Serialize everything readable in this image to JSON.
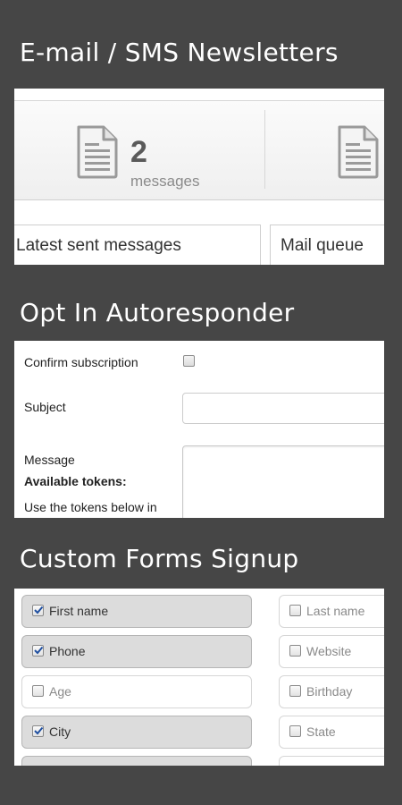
{
  "sections": {
    "newsletters": {
      "title": "E-mail / SMS Newsletters"
    },
    "autoresponder": {
      "title": "Opt In Autoresponder"
    },
    "custom_forms": {
      "title": "Custom Forms Signup"
    }
  },
  "stats": {
    "message_count": "2",
    "message_label": "messages"
  },
  "tabs": [
    {
      "label": "Latest sent messages"
    },
    {
      "label": "Mail queue"
    }
  ],
  "autoresponder_form": {
    "confirm_label": "Confirm subscription",
    "confirm_checked": false,
    "subject_label": "Subject",
    "subject_value": "",
    "message_label": "Message",
    "tokens_heading": "Available tokens:",
    "tokens_hint": "Use the tokens below in"
  },
  "signup_fields": [
    {
      "label": "First name",
      "checked": true
    },
    {
      "label": "Last name",
      "checked": false
    },
    {
      "label": "Phone",
      "checked": true
    },
    {
      "label": "Website",
      "checked": false
    },
    {
      "label": "Age",
      "checked": false
    },
    {
      "label": "Birthday",
      "checked": false
    },
    {
      "label": "City",
      "checked": true
    },
    {
      "label": "State",
      "checked": false
    }
  ],
  "colors": {
    "background": "#464646",
    "checked_field_bg": "#dcdcdc",
    "checkmark": "#1f4fa0"
  },
  "icons": {
    "message_stat": "document-icon"
  }
}
